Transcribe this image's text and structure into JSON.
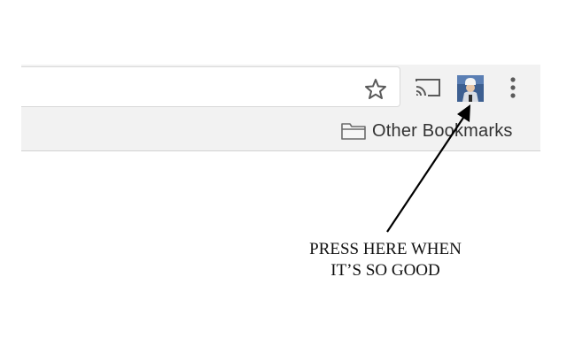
{
  "toolbar": {
    "icons": [
      "star-icon",
      "cast-icon",
      "avatar",
      "more-menu-icon"
    ]
  },
  "bookmarks_bar": {
    "folder_icon": "folder-icon",
    "folder_label": "Other Bookmarks"
  },
  "annotation": {
    "line1": "PRESS HERE WHEN",
    "line2": "IT’S SO GOOD"
  },
  "colors": {
    "toolbar_bg": "#f2f2f2",
    "icon": "#5a5a5a",
    "arrow": "#000000"
  }
}
